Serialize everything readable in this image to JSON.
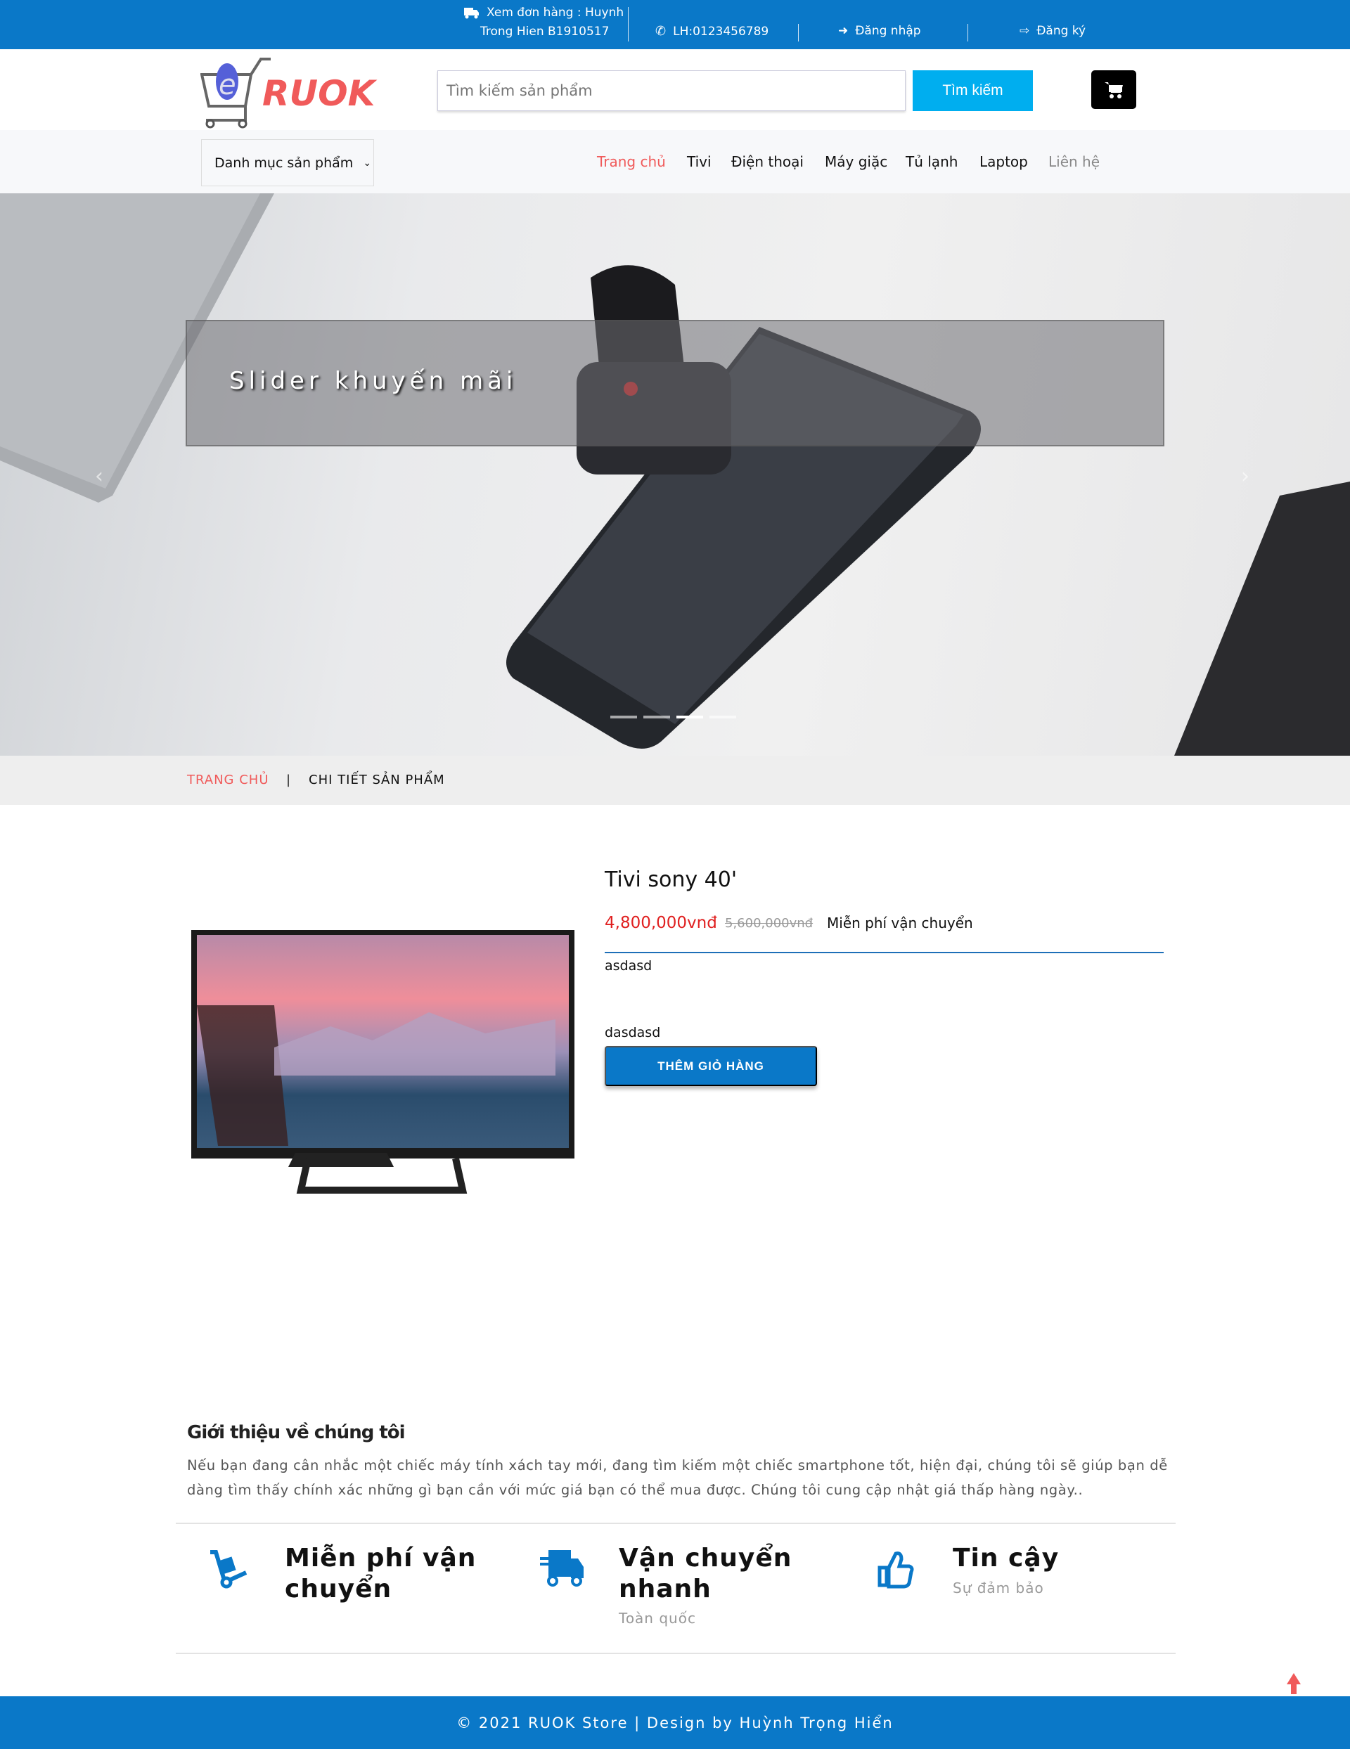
{
  "topbar": {
    "order_label": "Xem đơn hàng : Huynh",
    "order_label2": "Trong Hien B1910517",
    "phone": "LH:0123456789",
    "login": "Đăng nhập",
    "register": "Đăng ký"
  },
  "header": {
    "logo_text": "RUOK",
    "search_placeholder": "Tìm kiếm sản phẩm",
    "search_button": "Tìm kiếm"
  },
  "nav": {
    "category_select": "Danh mục sản phẩm",
    "links": [
      "Trang chủ",
      "Tivi",
      "Điện thoại",
      "Máy giặc",
      "Tủ lạnh",
      "Laptop",
      "Liên hệ"
    ]
  },
  "slider": {
    "caption": "Slider khuyến mãi",
    "slides": 4,
    "active_slide": 3
  },
  "breadcrumb": {
    "home": "TRANG CHỦ",
    "sep": "|",
    "current": "CHI TIẾT SẢN PHẨM"
  },
  "product": {
    "name": "Tivi sony 40'",
    "price": "4,800,000vnđ",
    "old_price": "5,600,000vnđ",
    "shipping": "Miễn phí vận chuyển",
    "desc1": "asdasd",
    "desc2": "dasdasd",
    "add_to_cart": "THÊM GIỎ HÀNG"
  },
  "about": {
    "title": "Giới thiệu về chúng tôi",
    "text": "Nếu bạn đang cân nhắc một chiếc máy tính xách tay mới, đang tìm kiếm một chiếc smartphone tốt, hiện đại, chúng tôi sẽ giúp bạn dễ dàng tìm thấy chính xác những gì bạn cần với mức giá bạn có thể mua được. Chúng tôi cung cập nhật giá thấp hàng ngày.."
  },
  "features": [
    {
      "icon": "hand-truck-icon",
      "title": "Miễn phí vận chuyển",
      "subtitle": ""
    },
    {
      "icon": "truck-icon",
      "title": "Vận chuyển nhanh",
      "subtitle": "Toàn quốc"
    },
    {
      "icon": "thumbs-up-icon",
      "title": "Tin cậy",
      "subtitle": "Sự đảm bảo"
    }
  ],
  "footer": {
    "text": "© 2021 RUOK Store | Design by Huỳnh Trọng Hiển"
  },
  "colors": {
    "primary": "#0a78c8",
    "accent": "#f05a5a",
    "search_button": "#00aeef",
    "price": "#e02020"
  }
}
